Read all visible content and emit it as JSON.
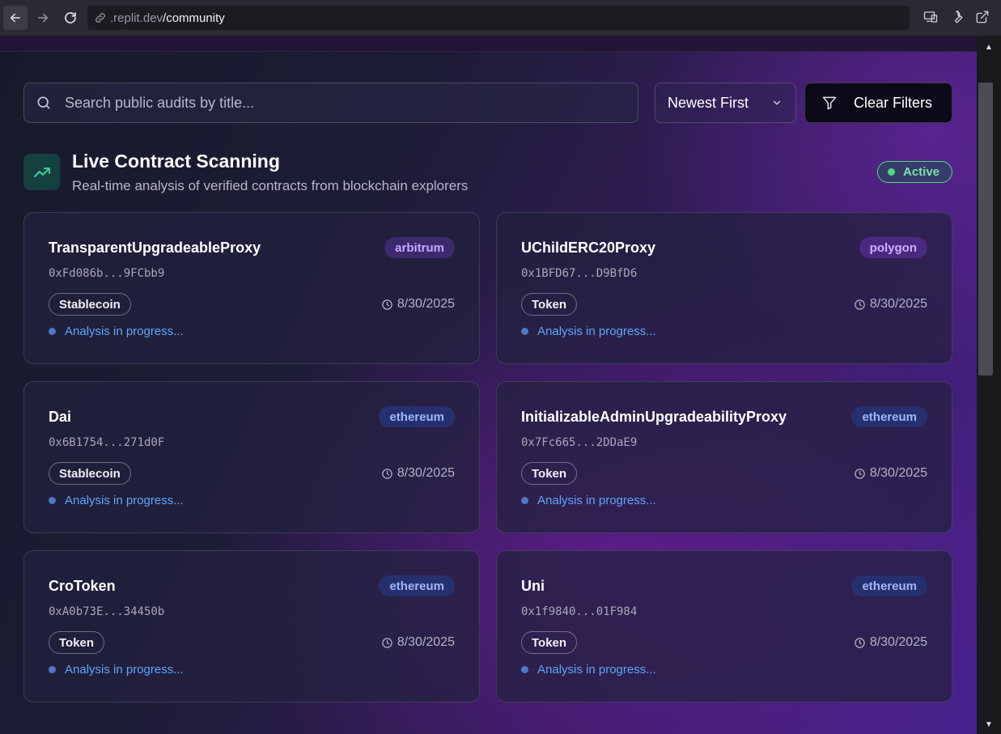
{
  "browser": {
    "url_domain": ".replit.dev",
    "url_path": "/community"
  },
  "toolbar": {
    "search_placeholder": "Search public audits by title...",
    "sort_label": "Newest First",
    "clear_label": "Clear Filters"
  },
  "section": {
    "title": "Live Contract Scanning",
    "subtitle": "Real-time analysis of verified contracts from blockchain explorers",
    "status": "Active"
  },
  "colors": {
    "arbitrum": "#3d2a6e",
    "polygon": "#4a2a80",
    "ethereum": "#27306e",
    "active": "#4ade80",
    "progress": "#60a5fa"
  },
  "cards": [
    {
      "title": "TransparentUpgradeableProxy",
      "chain": "arbitrum",
      "address": "0xFd086b...9FCbb9",
      "category": "Stablecoin",
      "date": "8/30/2025",
      "status": "Analysis in progress..."
    },
    {
      "title": "UChildERC20Proxy",
      "chain": "polygon",
      "address": "0x1BFD67...D9BfD6",
      "category": "Token",
      "date": "8/30/2025",
      "status": "Analysis in progress..."
    },
    {
      "title": "Dai",
      "chain": "ethereum",
      "address": "0x6B1754...271d0F",
      "category": "Stablecoin",
      "date": "8/30/2025",
      "status": "Analysis in progress..."
    },
    {
      "title": "InitializableAdminUpgradeabilityProxy",
      "chain": "ethereum",
      "address": "0x7Fc665...2DDaE9",
      "category": "Token",
      "date": "8/30/2025",
      "status": "Analysis in progress..."
    },
    {
      "title": "CroToken",
      "chain": "ethereum",
      "address": "0xA0b73E...34450b",
      "category": "Token",
      "date": "8/30/2025",
      "status": "Analysis in progress..."
    },
    {
      "title": "Uni",
      "chain": "ethereum",
      "address": "0x1f9840...01F984",
      "category": "Token",
      "date": "8/30/2025",
      "status": "Analysis in progress..."
    }
  ]
}
